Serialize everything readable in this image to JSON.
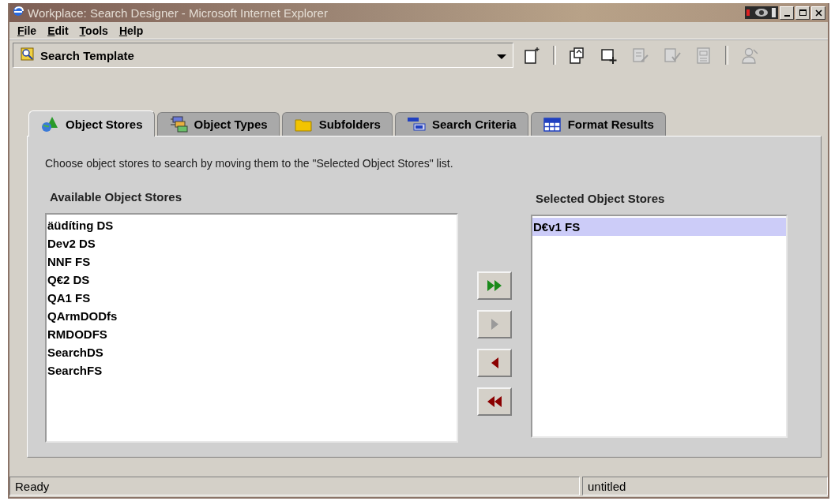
{
  "window": {
    "title": "Workplace: Search Designer - Microsoft Internet Explorer",
    "active": false
  },
  "menu": [
    "File",
    "Edit",
    "Tools",
    "Help"
  ],
  "toolbar": {
    "template": "Search Template",
    "buttons": [
      {
        "kind": "new",
        "disabled": false
      },
      {
        "kind": "separator"
      },
      {
        "kind": "open",
        "disabled": false
      },
      {
        "kind": "add",
        "disabled": false
      },
      {
        "kind": "edit",
        "disabled": true
      },
      {
        "kind": "check",
        "disabled": true
      },
      {
        "kind": "properties",
        "disabled": true
      },
      {
        "kind": "separator"
      },
      {
        "kind": "user",
        "disabled": true
      }
    ]
  },
  "tabs": [
    {
      "label": "Object Stores",
      "kind": "stores",
      "selected": true
    },
    {
      "label": "Object Types",
      "kind": "types",
      "selected": false
    },
    {
      "label": "Subfolders",
      "kind": "folders",
      "selected": false
    },
    {
      "label": "Search Criteria",
      "kind": "criteria",
      "selected": false
    },
    {
      "label": "Format Results",
      "kind": "format",
      "selected": false
    }
  ],
  "instructions": "Choose object stores to search by moving them to the \"Selected Object Stores\" list.",
  "available": {
    "heading": "Available Object Stores",
    "items": [
      {
        "label": "äüdíting DS",
        "selected": false
      },
      {
        "label": "Dev2 DS",
        "selected": false
      },
      {
        "label": "NNF FS",
        "selected": false
      },
      {
        "label": "Q€2 DS",
        "selected": false
      },
      {
        "label": "QA1 FS",
        "selected": false
      },
      {
        "label": "QArmDODfs",
        "selected": false
      },
      {
        "label": "RMDODFS",
        "selected": false
      },
      {
        "label": "SearchDS",
        "selected": false
      },
      {
        "label": "SearchFS",
        "selected": false
      }
    ]
  },
  "transfer": [
    {
      "kind": "add_all",
      "disabled": false
    },
    {
      "kind": "add",
      "disabled": true
    },
    {
      "kind": "remove",
      "disabled": false
    },
    {
      "kind": "remove_all",
      "disabled": false
    }
  ],
  "selected_list": {
    "heading": "Selected Object Stores",
    "items": [
      {
        "label": "D€v1 FS",
        "selected": true
      }
    ]
  },
  "status_bar": {
    "message": "Ready",
    "document": "untitled"
  }
}
